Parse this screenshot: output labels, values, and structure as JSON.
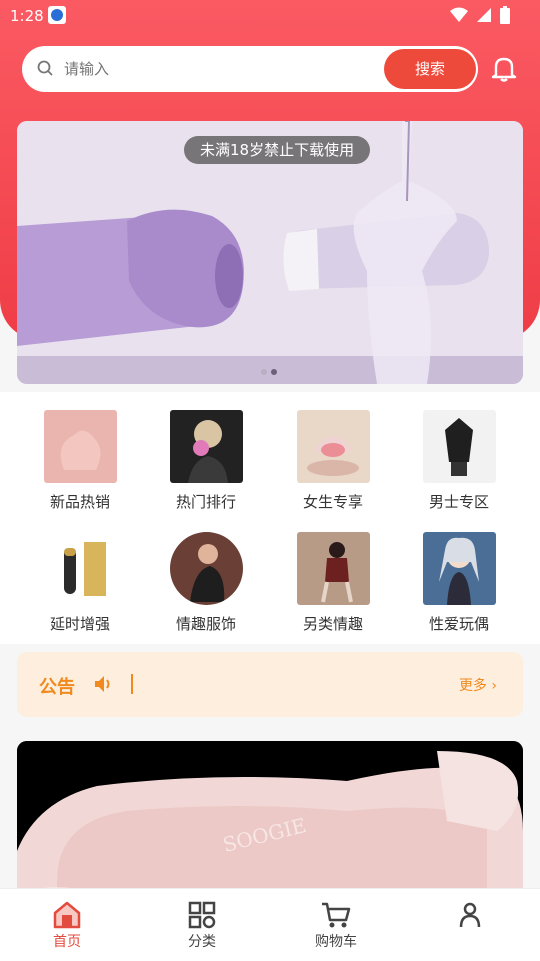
{
  "status": {
    "time": "1:28"
  },
  "search": {
    "placeholder": "请输入",
    "button": "搜索"
  },
  "banner": {
    "tag": "未满18岁禁止下载使用",
    "slide_count": 2,
    "active_slide": 2
  },
  "categories": [
    {
      "label": "新品热销"
    },
    {
      "label": "热门排行"
    },
    {
      "label": "女生专享"
    },
    {
      "label": "男士专区"
    },
    {
      "label": "延时增强"
    },
    {
      "label": "情趣服饰"
    },
    {
      "label": "另类情趣"
    },
    {
      "label": "性爱玩偶"
    }
  ],
  "notice": {
    "title": "公告",
    "text": "",
    "more": "更多"
  },
  "product": {
    "watermark": "SOOGIE"
  },
  "tabs": [
    {
      "label": "首页",
      "active": true
    },
    {
      "label": "分类",
      "active": false
    },
    {
      "label": "购物车",
      "active": false
    },
    {
      "label": "",
      "active": false
    }
  ],
  "colors": {
    "accent": "#ee4a3c",
    "header": "#f24a52",
    "notice_bg": "#fdeedd",
    "notice_text": "#f08a1e"
  }
}
